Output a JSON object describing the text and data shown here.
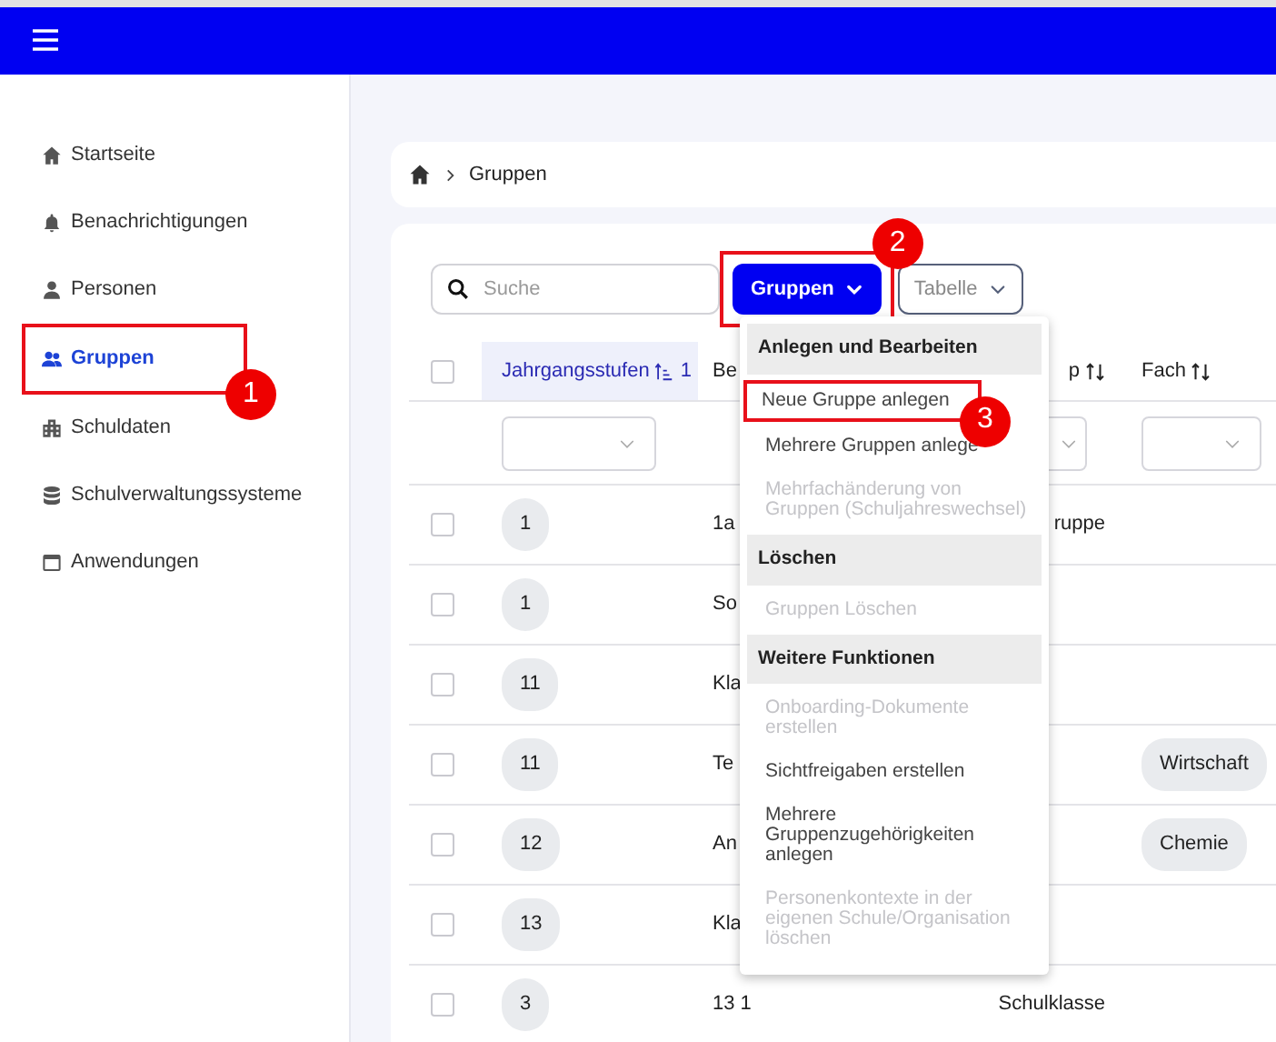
{
  "sidebar": {
    "items": [
      {
        "label": "Startseite",
        "selected": false
      },
      {
        "label": "Benachrichtigungen",
        "selected": false
      },
      {
        "label": "Personen",
        "selected": false
      },
      {
        "label": "Gruppen",
        "selected": true,
        "annotation": "1"
      },
      {
        "label": "Schuldaten",
        "selected": false
      },
      {
        "label": "Schulverwaltungssysteme",
        "selected": false
      },
      {
        "label": "Anwendungen",
        "selected": false
      }
    ]
  },
  "breadcrumb": {
    "current": "Gruppen"
  },
  "toolbar": {
    "search": {
      "placeholder": "Suche"
    },
    "buttons": [
      {
        "kind": "primary",
        "label": "Gruppen",
        "annotation": "2"
      },
      {
        "kind": "outline",
        "label": "Tabelle"
      }
    ]
  },
  "table": {
    "header_checked": false,
    "columns": [
      {
        "label": "Jahrgangsstufen",
        "sorted": true,
        "sort_index": "1",
        "filter": true
      },
      {
        "label": "Be",
        "sorted": false,
        "sort_arrows": false
      },
      {
        "label": "p",
        "sorted": false,
        "sort_arrows": true,
        "filter": true
      },
      {
        "label": "Fach",
        "sorted": false,
        "sort_arrows": true,
        "filter": true
      }
    ],
    "rows": [
      {
        "checked": false,
        "grade": "1",
        "name": "1a",
        "type": "ruppe"
      },
      {
        "checked": false,
        "grade": "1",
        "name": "So"
      },
      {
        "checked": false,
        "grade": "11",
        "name": "Kla"
      },
      {
        "checked": false,
        "grade": "11",
        "name": "Te",
        "subject": "Wirtschaft"
      },
      {
        "checked": false,
        "grade": "12",
        "name": "An",
        "subject": "Chemie"
      },
      {
        "checked": false,
        "grade": "13",
        "name": "Kla"
      },
      {
        "checked": false,
        "grade": "3",
        "name": "13 1",
        "type": "Schulklasse"
      }
    ]
  },
  "dropdown_menu": {
    "items": [
      {
        "kind": "header",
        "label": "Anlegen und Bearbeiten"
      },
      {
        "kind": "item",
        "label": "Neue Gruppe anlegen",
        "disabled": false,
        "annotation": "3"
      },
      {
        "kind": "item",
        "label": "Mehrere Gruppen anlege",
        "disabled": false
      },
      {
        "kind": "item",
        "label": "Mehrfachänderung von Gruppen (Schuljahreswechsel)",
        "disabled": true
      },
      {
        "kind": "header",
        "label": "Löschen"
      },
      {
        "kind": "item",
        "label": "Gruppen Löschen",
        "disabled": true
      },
      {
        "kind": "header",
        "label": "Weitere Funktionen"
      },
      {
        "kind": "item",
        "label": "Onboarding-Dokumente erstellen",
        "disabled": true
      },
      {
        "kind": "item",
        "label": "Sichtfreigaben erstellen",
        "disabled": false
      },
      {
        "kind": "item",
        "label": "Mehrere Gruppenzugehörigkeiten anlegen",
        "disabled": false
      },
      {
        "kind": "item",
        "label": "Personenkontexte in der eigenen Schule/Organisation löschen",
        "disabled": true
      }
    ]
  }
}
